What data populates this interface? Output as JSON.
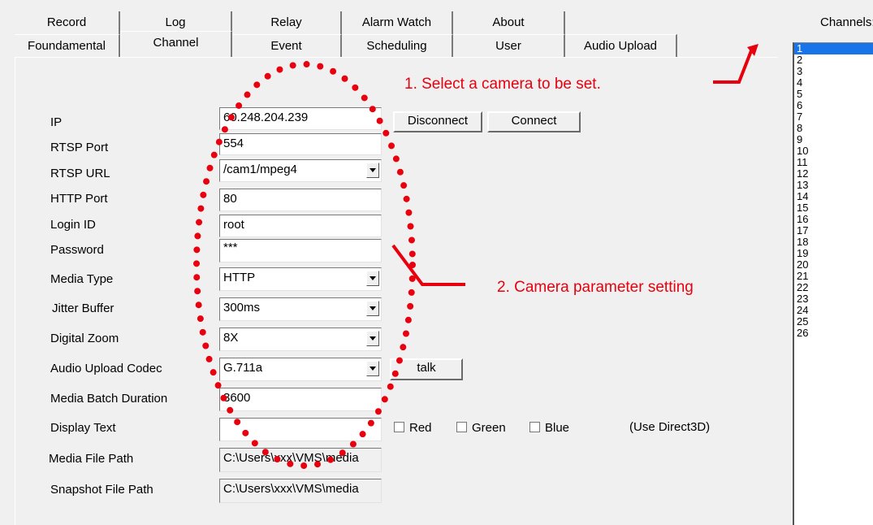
{
  "tabs_row1": [
    "Record",
    "Log",
    "Relay",
    "Alarm Watch",
    "About"
  ],
  "tabs_row2": [
    "Foundamental",
    "Channel",
    "Event",
    "Scheduling",
    "User",
    "Audio Upload"
  ],
  "active_tab": "Channel",
  "channels_label": "Channels:",
  "channels": [
    "1",
    "2",
    "3",
    "4",
    "5",
    "6",
    "7",
    "8",
    "9",
    "10",
    "11",
    "12",
    "13",
    "14",
    "15",
    "16",
    "17",
    "18",
    "19",
    "20",
    "21",
    "22",
    "23",
    "24",
    "25",
    "26"
  ],
  "selected_channel": "1",
  "form": {
    "ip_label": "IP",
    "ip_value": "60.248.204.239",
    "rtsp_port_label": "RTSP Port",
    "rtsp_port_value": "554",
    "rtsp_url_label": "RTSP URL",
    "rtsp_url_value": "/cam1/mpeg4",
    "http_port_label": "HTTP Port",
    "http_port_value": "80",
    "login_id_label": "Login ID",
    "login_id_value": "root",
    "password_label": "Password",
    "password_value": "***",
    "media_type_label": "Media Type",
    "media_type_value": "HTTP",
    "jitter_label": "Jitter Buffer",
    "jitter_value": "300ms",
    "zoom_label": "Digital Zoom",
    "zoom_value": "8X",
    "codec_label": "Audio Upload Codec",
    "codec_value": "G.711a",
    "batch_label": "Media Batch Duration",
    "batch_value": "3600",
    "display_text_label": "Display Text",
    "display_text_value": "",
    "media_path_label": "Media File Path",
    "media_path_value": "C:\\Users\\xxx\\VMS\\media",
    "snapshot_path_label": "Snapshot File Path",
    "snapshot_path_value": "C:\\Users\\xxx\\VMS\\media"
  },
  "buttons": {
    "disconnect": "Disconnect",
    "connect": "Connect",
    "talk": "talk"
  },
  "checkboxes": {
    "red": "Red",
    "green": "Green",
    "blue": "Blue",
    "note": "(Use Direct3D)"
  },
  "annotations": {
    "step1": "1. Select a camera to be set.",
    "step2": "2. Camera parameter setting",
    "color": "#e8000f"
  }
}
